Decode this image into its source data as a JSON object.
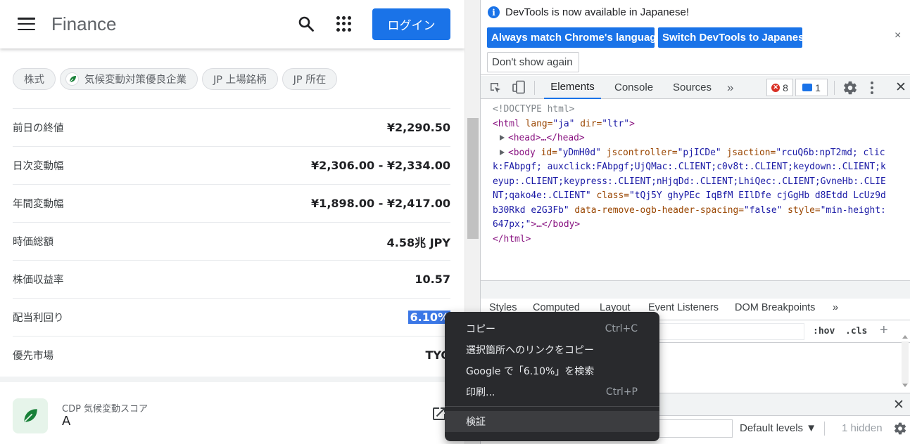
{
  "page": {
    "logo": "Finance",
    "login_label": "ログイン",
    "chips": [
      {
        "label": "株式"
      },
      {
        "label": "気候変動対策優良企業"
      },
      {
        "label": "JP 上場銘柄"
      },
      {
        "label": "JP 所在"
      }
    ],
    "stats": [
      {
        "label": "前日の終値",
        "value": "¥2,290.50"
      },
      {
        "label": "日次変動幅",
        "value": "¥2,306.00 - ¥2,334.00"
      },
      {
        "label": "年間変動幅",
        "value": "¥1,898.00 - ¥2,417.00"
      },
      {
        "label": "時価総額",
        "value": "4.58兆 JPY"
      },
      {
        "label": "株価収益率",
        "value": "10.57"
      },
      {
        "label": "配当利回り",
        "value": "6.10%"
      },
      {
        "label": "優先市場",
        "value": "TYO"
      }
    ],
    "cdp": {
      "label": "CDP 気候変動スコア",
      "value": "A"
    }
  },
  "devtools": {
    "infobar": {
      "message": "DevTools is now available in Japanese!",
      "match_label": "Always match Chrome's language",
      "switch_label": "Switch DevTools to Japanese",
      "dont_show_label": "Don't show again",
      "close": "×"
    },
    "tabs": {
      "elements": "Elements",
      "console": "Console",
      "sources": "Sources",
      "more": "»"
    },
    "badges": {
      "errors": "8",
      "messages": "1"
    },
    "close": "✕",
    "dom": {
      "doctype": "<!DOCTYPE html>",
      "html_open_tag": "<html",
      "html_attrs": " lang=",
      "html_lang": "\"ja\"",
      "html_dir_attr": " dir=",
      "html_dir": "\"ltr\"",
      "html_close_angle": ">",
      "head": "<head>…</head>",
      "body_line1": "\"rcuQ6b:npT2md; clic",
      "body_line2": "k:FAbpgf; auxclick:FAbpgf;UjQMac:.CLIENT;c0v8t:.CLIENT;keydown:.CLIENT;k",
      "body_line3": "eyup:.CLIENT;keypress:.CLIENT;nHjqDd:.CLIENT;LhiQec:.CLIENT;GvneHb:.CLIE",
      "body_line4a": "NT;qako4e:.CLIENT\"",
      "body_class_val": "\"tQj5Y ghyPEc IqBfM EIlDfe cjGgHb d8Etdd LcUz9d",
      "body_line5a": "b30Rkd e2G3Fb\"",
      "body_data_attr": " data-remove-ogb-header-spacing=",
      "body_data_val": "\"false\"",
      "body_style_attr": " style=",
      "body_style_val": "\"min-height:",
      "body_line6a": "647px;\"",
      "body_line6b": ">…</body>",
      "body_id_attr": " id=",
      "body_id_val": "\"yDmH0d\"",
      "body_jsc_attr": " jscontroller=",
      "body_jsc_val": "\"pjICDe\"",
      "body_jsa_attr": " jsaction=",
      "body_tag": "<body",
      "body_class_attr": " class=",
      "html_close": "</html>"
    },
    "styles_tabs": [
      "Styles",
      "Computed",
      "Layout",
      "Event Listeners",
      "DOM Breakpoints",
      "»"
    ],
    "styles_tools": {
      "hov": ":hov",
      "cls": ".cls",
      "plus": "+"
    },
    "drawer_close": "✕",
    "console": {
      "levels": "Default levels ▼",
      "hidden": "1 hidden"
    }
  },
  "context_menu": {
    "items": [
      {
        "label": "コピー",
        "shortcut": "Ctrl+C"
      },
      {
        "label": "選択箇所へのリンクをコピー",
        "shortcut": ""
      },
      {
        "label": "Google で「6.10%」を検索",
        "shortcut": ""
      },
      {
        "label": "印刷...",
        "shortcut": "Ctrl+P"
      },
      {
        "label": "検証",
        "shortcut": ""
      }
    ]
  },
  "colors": {
    "accent": "#1a73e8",
    "menu_bg": "#292a2d",
    "selection": "#3b77e6"
  }
}
